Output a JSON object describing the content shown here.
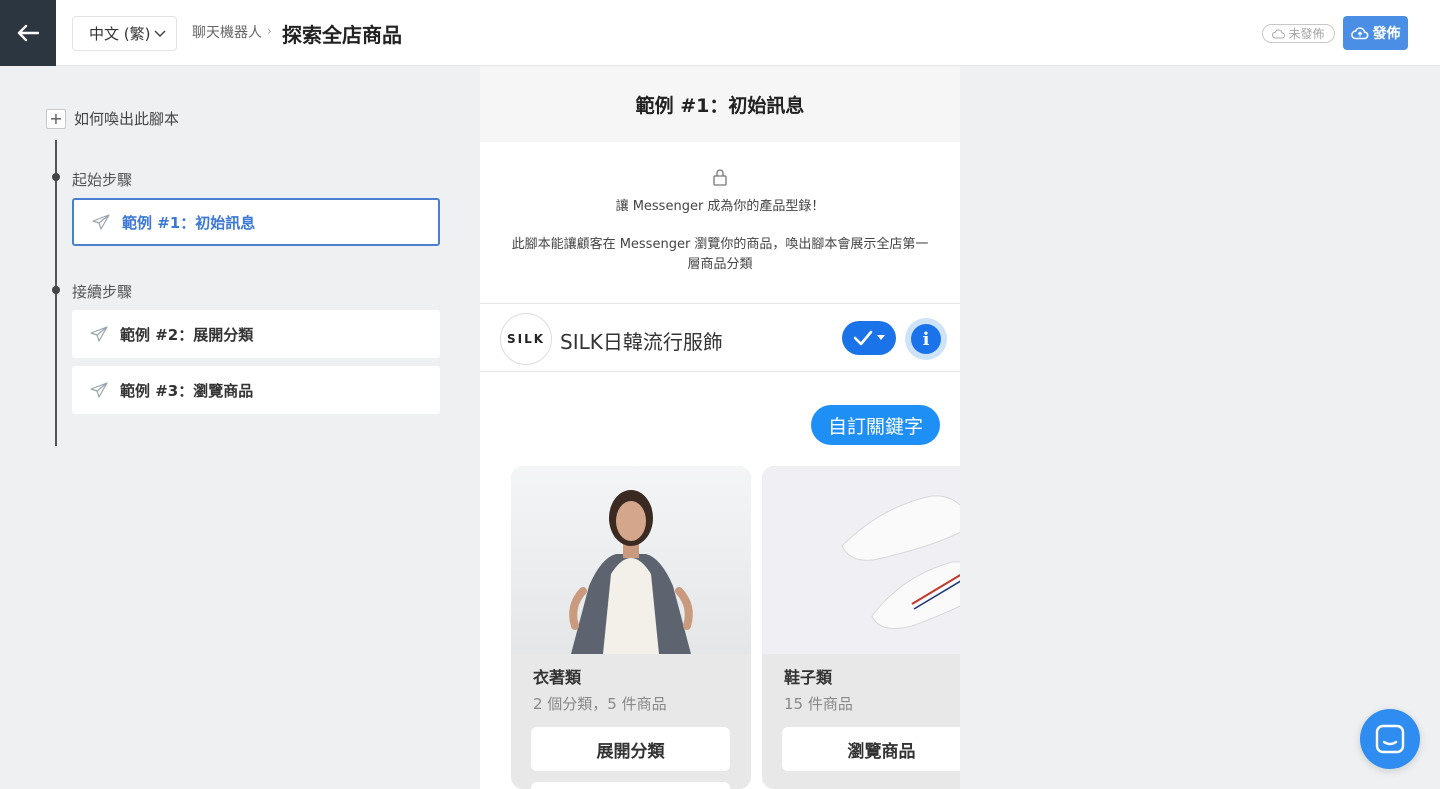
{
  "topbar": {
    "language": "中文 (繁)",
    "breadcrumb": "聊天機器人",
    "breadcrumb_sep": "›",
    "title": "探索全店商品",
    "unpublished_label": "未發佈",
    "publish_label": "發佈"
  },
  "sidebar": {
    "add_trigger_label": "如何喚出此腳本",
    "start_section_label": "起始步驟",
    "next_section_label": "接續步驟",
    "steps": [
      {
        "label": "範例 #1：初始訊息"
      },
      {
        "label": "範例 #2：展開分類"
      },
      {
        "label": "範例 #3：瀏覽商品"
      }
    ]
  },
  "preview": {
    "header_title": "範例 #1：初始訊息",
    "intro_line1": "讓 Messenger 成為你的產品型錄！",
    "intro_line2": "此腳本能讓顧客在 Messenger 瀏覽你的商品，喚出腳本會展示全店第一層商品分類",
    "shop_logo_text": "SILK",
    "shop_name": "SILK日韓流行服飾",
    "user_message": "自訂關鍵字",
    "cards": [
      {
        "title": "衣著類",
        "subtitle": "2 個分類，5 件商品",
        "button": "展開分類",
        "image": "woman-in-jacket"
      },
      {
        "title": "鞋子類",
        "subtitle": "15 件商品",
        "button": "瀏覽商品",
        "image": "white-sneakers"
      }
    ]
  },
  "colors": {
    "accent": "#4a8ee6",
    "messenger_blue": "#1a73e8",
    "back_bg": "#2b3640"
  }
}
